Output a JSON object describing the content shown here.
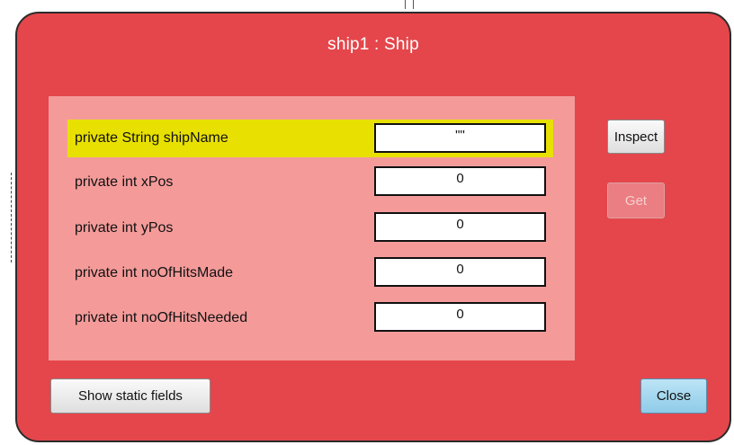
{
  "window": {
    "title": "ship1 : Ship"
  },
  "fields": [
    {
      "label": "private String shipName",
      "value": "\"\""
    },
    {
      "label": "private int xPos",
      "value": "0"
    },
    {
      "label": "private int yPos",
      "value": "0"
    },
    {
      "label": "private int noOfHitsMade",
      "value": "0"
    },
    {
      "label": "private int noOfHitsNeeded",
      "value": "0"
    }
  ],
  "buttons": {
    "inspect": "Inspect",
    "get": "Get",
    "show_static": "Show static fields",
    "close": "Close"
  },
  "colors": {
    "window_background": "#e4464b",
    "fields_panel": "#f49b9a",
    "selected_row": "#e8e000",
    "close_button": "#8ecbe8"
  }
}
